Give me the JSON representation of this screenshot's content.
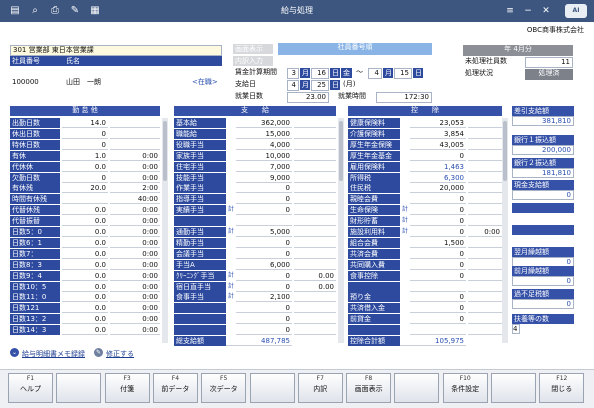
{
  "window": {
    "title": "給与処理",
    "company": "OBC商事株式会社"
  },
  "employee": {
    "dept": "301 営業部 東日本営業課",
    "col_no": "社員番号",
    "col_name": "氏名",
    "no": "100000",
    "name": "山田　一朗",
    "status": "<在職>"
  },
  "fields": {
    "emp_no_btn": "社員番号順",
    "sched_disp": "画面表示",
    "calc_period_lbl": "賃金計算期間",
    "calc_from_m": "3",
    "calc_from_m_u": "月",
    "calc_from_d": "16",
    "calc_from_d_u": "日",
    "calc_from_w": "金",
    "tilde": "～",
    "calc_to_m": "4",
    "calc_to_m_u": "月",
    "calc_to_d": "15",
    "calc_to_d_u": "日",
    "pay_date_lbl": "支給日",
    "pay_m": "4",
    "pay_m_u": "月",
    "pay_d": "25",
    "pay_d_u": "日",
    "pay_w": "(月)",
    "work_days_lbl": "就業日数",
    "work_days": "23.00",
    "work_hours_lbl": "就業時間",
    "work_hours": "172:30"
  },
  "right_info": {
    "month": "年 4月分",
    "unproc_lbl": "未処理社員数",
    "unproc": "11",
    "status_lbl": "処理状況",
    "status": "処理済"
  },
  "attendance": {
    "title": "勤 怠 他",
    "rows": [
      {
        "label": "出勤日数",
        "v1": "14.0",
        "v2": ""
      },
      {
        "label": "休出日数",
        "v1": "0",
        "v2": ""
      },
      {
        "label": "特休日数",
        "v1": "0",
        "v2": ""
      },
      {
        "label": "有休",
        "v1": "1.0",
        "v2": "0:00"
      },
      {
        "label": "代休休",
        "v1": "0.0",
        "v2": "0:00"
      },
      {
        "label": "欠勤日数",
        "v1": "0",
        "v2": "0:00"
      },
      {
        "label": "有休残",
        "v1": "20.0",
        "v2": "2:00"
      },
      {
        "label": "時間有休残",
        "v1": "",
        "v2": "40:00"
      },
      {
        "label": "代替休残",
        "v1": "0.0",
        "v2": "0:00"
      },
      {
        "label": "代替振替",
        "v1": "0.0",
        "v2": "0:00"
      },
      {
        "label": "日数5：0",
        "v1": "0.0",
        "v2": "0:00"
      },
      {
        "label": "日数6：1",
        "v1": "0.0",
        "v2": "0:00"
      },
      {
        "label": "日数7：",
        "v1": "0.0",
        "v2": "0:00"
      },
      {
        "label": "日数8：3",
        "v1": "0.0",
        "v2": "0:00"
      },
      {
        "label": "日数9：4",
        "v1": "0.0",
        "v2": "0:00"
      },
      {
        "label": "日数10：5",
        "v1": "0.0",
        "v2": "0:00"
      },
      {
        "label": "日数11：0",
        "v1": "0.0",
        "v2": "0:00"
      },
      {
        "label": "日数121",
        "v1": "0.0",
        "v2": "0:00"
      },
      {
        "label": "日数13：2",
        "v1": "0.0",
        "v2": "0:00"
      },
      {
        "label": "日数14：3",
        "v1": "0.0",
        "v2": "0:00"
      }
    ]
  },
  "payment": {
    "title": "支　　給",
    "rows": [
      {
        "label": "基本給",
        "calc": "",
        "v": "362,000",
        "v2": ""
      },
      {
        "label": "職能給",
        "calc": "",
        "v": "15,000",
        "v2": ""
      },
      {
        "label": "役職手当",
        "calc": "",
        "v": "4,000",
        "v2": ""
      },
      {
        "label": "家族手当",
        "calc": "",
        "v": "10,000",
        "v2": ""
      },
      {
        "label": "住宅手当",
        "calc": "",
        "v": "7,000",
        "v2": ""
      },
      {
        "label": "技能手当",
        "calc": "",
        "v": "9,000",
        "v2": ""
      },
      {
        "label": "作業手当",
        "calc": "",
        "v": "0",
        "v2": ""
      },
      {
        "label": "指導手当",
        "calc": "",
        "v": "0",
        "v2": ""
      },
      {
        "label": "実績手当",
        "calc": "計",
        "v": "0",
        "v2": ""
      },
      {
        "label": "",
        "calc": "",
        "v": "",
        "v2": ""
      },
      {
        "label": "通勤手当",
        "calc": "計",
        "v": "5,000",
        "v2": ""
      },
      {
        "label": "精勤手当",
        "calc": "",
        "v": "0",
        "v2": ""
      },
      {
        "label": "会議手当",
        "calc": "",
        "v": "0",
        "v2": ""
      },
      {
        "label": "手当A",
        "calc": "",
        "v": "6,000",
        "v2": ""
      },
      {
        "label": "ｸﾘｰﾆﾝｸﾞ手当",
        "calc": "計",
        "v": "0",
        "v2": "0.00"
      },
      {
        "label": "宿日直手当",
        "calc": "計",
        "v": "0",
        "v2": "0.00"
      },
      {
        "label": "食事手当",
        "calc": "計",
        "v": "2,100",
        "v2": ""
      },
      {
        "label": "",
        "calc": "",
        "v": "0",
        "v2": ""
      },
      {
        "label": "",
        "calc": "",
        "v": "0",
        "v2": ""
      },
      {
        "label": "",
        "calc": "",
        "v": "0",
        "v2": ""
      }
    ],
    "total_lbl": "総支給額",
    "total": "487,785"
  },
  "deduction": {
    "title": "控　　除",
    "rows": [
      {
        "label": "健康保険料",
        "calc": "",
        "v": "23,053",
        "v2": "",
        "blue": false
      },
      {
        "label": "介護保険料",
        "calc": "",
        "v": "3,854",
        "v2": "",
        "blue": false
      },
      {
        "label": "厚生年金保険",
        "calc": "",
        "v": "43,005",
        "v2": "",
        "blue": false
      },
      {
        "label": "厚生年金基金",
        "calc": "",
        "v": "0",
        "v2": "",
        "blue": false
      },
      {
        "label": "雇用保険料",
        "calc": "",
        "v": "1,463",
        "v2": "",
        "blue": true
      },
      {
        "label": "所得税",
        "calc": "",
        "v": "6,300",
        "v2": "",
        "blue": true
      },
      {
        "label": "住民税",
        "calc": "",
        "v": "20,000",
        "v2": "",
        "blue": false
      },
      {
        "label": "親睦会費",
        "calc": "",
        "v": "0",
        "v2": "",
        "blue": false
      },
      {
        "label": "生命保険",
        "calc": "計",
        "v": "0",
        "v2": "",
        "blue": false
      },
      {
        "label": "財形貯蓄",
        "calc": "計",
        "v": "0",
        "v2": "",
        "blue": false
      },
      {
        "label": "施設利用料",
        "calc": "計",
        "v": "0",
        "v2": "0:00",
        "blue": false
      },
      {
        "label": "組合会費",
        "calc": "",
        "v": "1,500",
        "v2": "",
        "blue": false
      },
      {
        "label": "共済会費",
        "calc": "",
        "v": "0",
        "v2": "",
        "blue": false
      },
      {
        "label": "共同購入費",
        "calc": "",
        "v": "0",
        "v2": "",
        "blue": false
      },
      {
        "label": "食事控除",
        "calc": "",
        "v": "0",
        "v2": "",
        "blue": false
      },
      {
        "label": "",
        "calc": "",
        "v": "",
        "v2": "",
        "blue": false
      },
      {
        "label": "預り金",
        "calc": "",
        "v": "0",
        "v2": "",
        "blue": false
      },
      {
        "label": "共済借入金",
        "calc": "",
        "v": "0",
        "v2": "",
        "blue": false
      },
      {
        "label": "前貸金",
        "calc": "",
        "v": "0",
        "v2": "",
        "blue": false
      },
      {
        "label": "",
        "calc": "",
        "v": "",
        "v2": "",
        "blue": false
      }
    ],
    "total_lbl": "控除合計額",
    "total": "105,975"
  },
  "side": [
    {
      "label": "差引支給額",
      "value": "381,810"
    },
    {
      "label": "銀行１振込額",
      "value": "200,000"
    },
    {
      "label": "銀行２振込額",
      "value": "181,810"
    },
    {
      "label": "現金支給額",
      "value": "0"
    },
    {
      "label": "翌月繰越額",
      "value": "0"
    },
    {
      "label": "前月繰越額",
      "value": "0"
    },
    {
      "label": "過不足税額",
      "value": "0"
    },
    {
      "label": "扶養等の数",
      "value": "4"
    }
  ],
  "links": {
    "memo": "給与明細書メモ録録",
    "edit": "修正する"
  },
  "fkeys": [
    {
      "n": "F1",
      "t": "ヘルプ"
    },
    {
      "n": "",
      "t": ""
    },
    {
      "n": "F3",
      "t": "付箋"
    },
    {
      "n": "F4",
      "t": "前データ"
    },
    {
      "n": "F5",
      "t": "次データ"
    },
    {
      "n": "",
      "t": ""
    },
    {
      "n": "F7",
      "t": "内訳"
    },
    {
      "n": "F8",
      "t": "画面表示"
    },
    {
      "n": "",
      "t": ""
    },
    {
      "n": "F10",
      "t": "条件設定"
    },
    {
      "n": "",
      "t": ""
    },
    {
      "n": "F12",
      "t": "閉じる"
    }
  ],
  "colors": {
    "titlebar": "#3d5680",
    "label_blue": "#2d4a9f",
    "value_blue": "#2a4fb0"
  }
}
